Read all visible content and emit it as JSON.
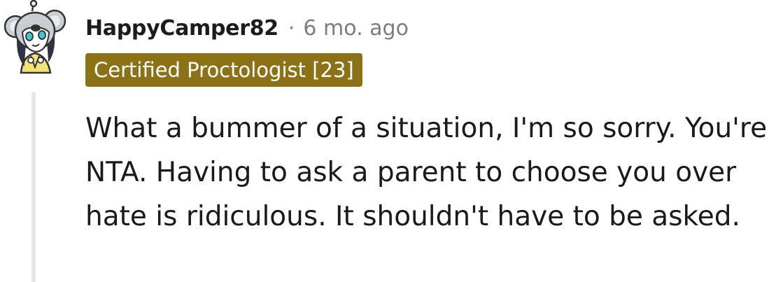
{
  "comment": {
    "username": "HappyCamper82",
    "separator": "·",
    "timestamp": "6 mo. ago",
    "flair": "Certified Proctologist [23]",
    "body": "What a bummer of a situation, I'm so sorry. You're NTA. Having to ask a parent to choose you over hate is ridiculous. It shouldn't have to be asked."
  },
  "avatar": {
    "icon": "koala-avatar-icon"
  },
  "colors": {
    "flair_background": "#8b7216",
    "flair_text": "#ffffff",
    "username": "#1c1c1c",
    "meta_gray": "#7c7c7c",
    "thread_line": "#e4e6e8",
    "body_text": "#1a1a1b"
  }
}
